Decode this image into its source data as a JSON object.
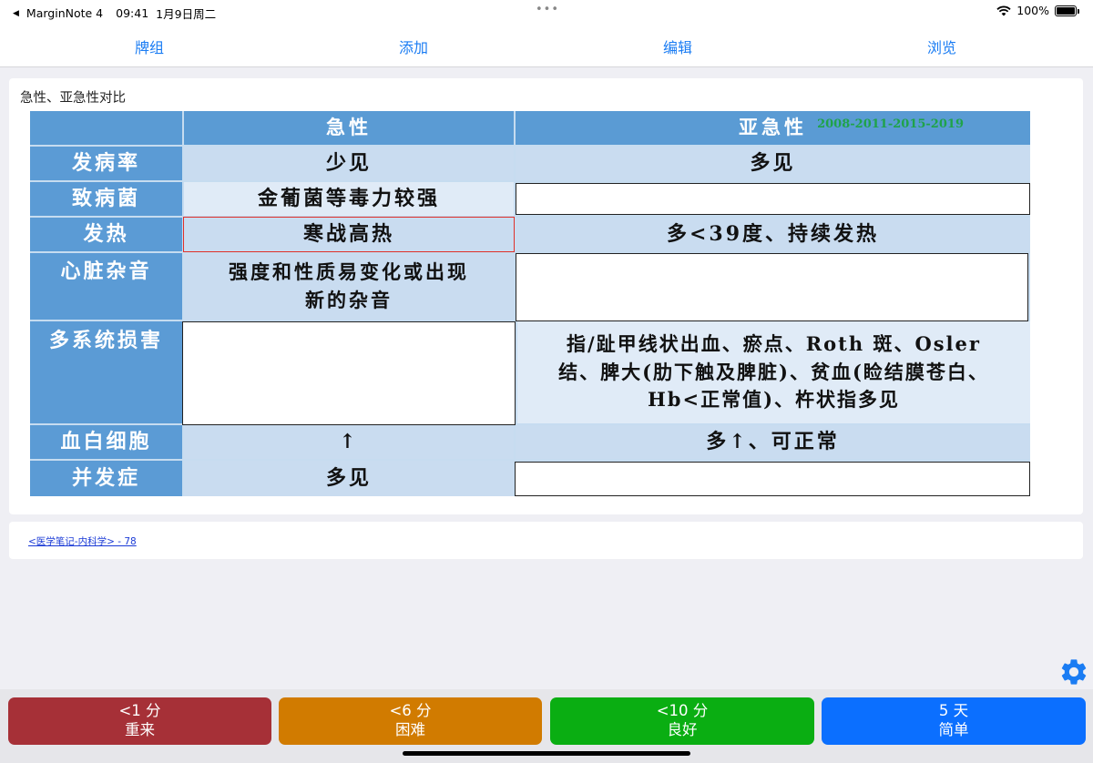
{
  "status_bar": {
    "app_back": "MarginNote 4",
    "time": "09:41",
    "date": "1月9日周二",
    "battery": "100%"
  },
  "toolbar": {
    "deck": "牌组",
    "add": "添加",
    "edit": "编辑",
    "browse": "浏览"
  },
  "card": {
    "title": "急性、亚急性对比",
    "table": {
      "header_acute": "急性",
      "header_subacute": "亚急性",
      "header_years": "2008-2011-2015-2019",
      "rows": [
        {
          "label": "发病率",
          "acute": "少见",
          "subacute": "多见"
        },
        {
          "label": "致病菌",
          "acute": "金葡菌等毒力较强",
          "subacute": ""
        },
        {
          "label": "发热",
          "acute": "寒战高热",
          "subacute": "多<39度、持续发热"
        },
        {
          "label": "心脏杂音",
          "acute_line1": "强度和性质易变化或出现",
          "acute_line2": "新的杂音",
          "subacute": ""
        },
        {
          "label": "多系统损害",
          "acute": "",
          "subacute_line1": "指/趾甲线状出血、瘀点、Roth 斑、Osler",
          "subacute_line2": "结、脾大(肋下触及脾脏)、贫血(睑结膜苍白、",
          "subacute_line3": "Hb<正常值)、杵状指多见"
        },
        {
          "label": "血白细胞",
          "acute": "↑",
          "subacute": "多↑、可正常"
        },
        {
          "label": "并发症",
          "acute": "多见",
          "subacute": ""
        }
      ]
    }
  },
  "source": {
    "link": "<医学笔记-内科学> - 78"
  },
  "answers": [
    {
      "time": "<1 分",
      "label": "重来",
      "color": "#a63037"
    },
    {
      "time": "<6 分",
      "label": "困难",
      "color": "#d17b00"
    },
    {
      "time": "<10 分",
      "label": "良好",
      "color": "#0aae12"
    },
    {
      "time": "5 天",
      "label": "简单",
      "color": "#0b6fff"
    }
  ],
  "colors": {
    "accent": "#1a7cf3",
    "table_header": "#5a9bd4",
    "table_cell": "#c9dcf0",
    "years_green": "#1fa34a"
  },
  "icons": [
    "wifi-icon",
    "battery-icon",
    "gear-icon",
    "back-arrow-icon"
  ]
}
